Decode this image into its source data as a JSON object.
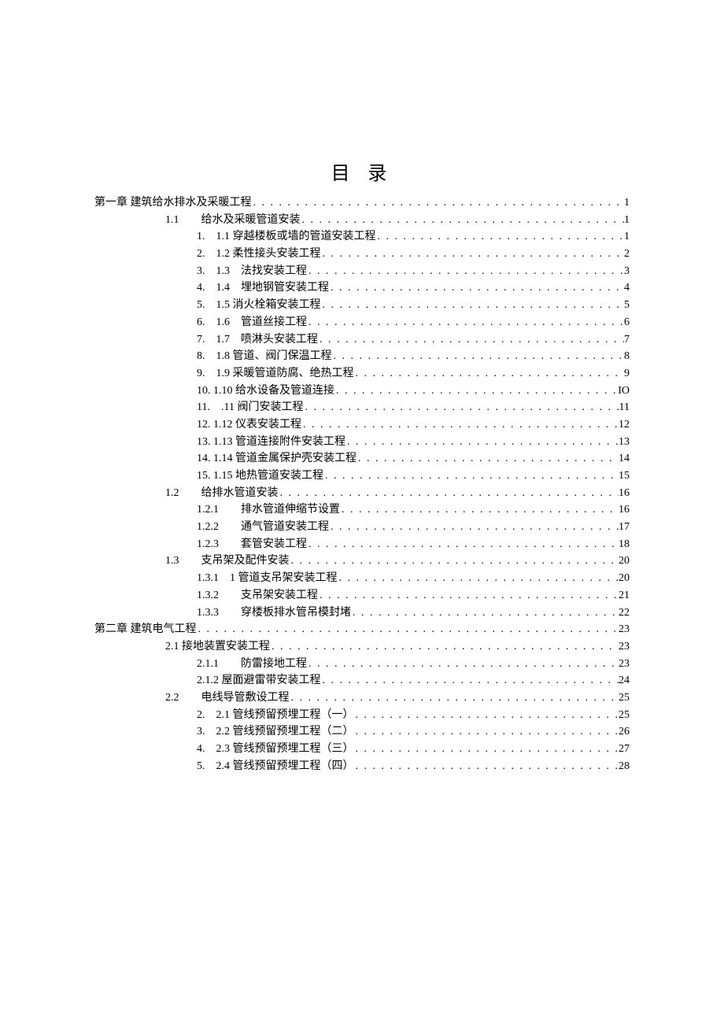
{
  "title": "目 录",
  "entries": [
    {
      "level": 0,
      "text": "第一章 建筑给水排水及采暖工程",
      "page": "1"
    },
    {
      "level": 1,
      "text": "1.1　　给水及采暖管道安装",
      "page": "1"
    },
    {
      "level": 2,
      "text": "1.　1.1 穿越楼板或墙的管道安装工程",
      "page": "1"
    },
    {
      "level": 2,
      "text": "2.　1.2 柔性接头安装工程",
      "page": "2"
    },
    {
      "level": 2,
      "text": "3.　1.3　法找安装工程",
      "page": "3"
    },
    {
      "level": 2,
      "text": "4.　1.4　埋地钢管安装工程",
      "page": "4"
    },
    {
      "level": 2,
      "text": "5.　1.5 消火栓箱安装工程",
      "page": "5"
    },
    {
      "level": 2,
      "text": "6.　1.6　管道丝接工程",
      "page": "6"
    },
    {
      "level": 2,
      "text": "7.　1.7　喷淋头安装工程",
      "page": "7"
    },
    {
      "level": 2,
      "text": "8.　1.8 管道、阀门保温工程",
      "page": "8"
    },
    {
      "level": 2,
      "text": "9.　1.9 采暖管道防腐、绝热工程",
      "page": "9"
    },
    {
      "level": 2,
      "text": "10. 1.10 给水设备及管道连接",
      "page": "IO"
    },
    {
      "level": 2,
      "text": "11.　.11 阀门安装工程",
      "page": "11"
    },
    {
      "level": 2,
      "text": "12. 1.12 仪表安装工程",
      "page": "12"
    },
    {
      "level": 2,
      "text": "13. 1.13 管道连接附件安装工程",
      "page": "13"
    },
    {
      "level": 2,
      "text": "14. 1.14 管道金属保护壳安装工程",
      "page": "14"
    },
    {
      "level": 2,
      "text": "15. 1.15 地热管道安装工程",
      "page": "15"
    },
    {
      "level": 1,
      "text": "1.2　　给排水管道安装",
      "page": "16"
    },
    {
      "level": 2,
      "text": "1.2.1　　排水管道伸缩节设置",
      "page": "16"
    },
    {
      "level": 2,
      "text": "1.2.2　　通气管道安装工程",
      "page": "17"
    },
    {
      "level": 2,
      "text": "1.2.3　　套管安装工程",
      "page": "18"
    },
    {
      "level": 1,
      "text": "1.3　　支吊架及配件安装",
      "page": "20"
    },
    {
      "level": 2,
      "text": "1.3.1　1 管道支吊架安装工程",
      "page": "20"
    },
    {
      "level": 2,
      "text": "1.3.2　　支吊架安装工程",
      "page": "21"
    },
    {
      "level": 2,
      "text": "1.3.3　　穿楼板排水管吊模封堵",
      "page": "22"
    },
    {
      "level": 0,
      "text": "第二章 建筑电气工程",
      "page": "23"
    },
    {
      "level": 1,
      "text": "2.1 接地装置安装工程",
      "page": "23"
    },
    {
      "level": 2,
      "text": "2.1.1　　防雷接地工程",
      "page": "23"
    },
    {
      "level": 2,
      "text": "2.1.2 屋面避雷带安装工程",
      "page": "24"
    },
    {
      "level": 1,
      "text": "2.2　　电线导管敷设工程",
      "page": "25"
    },
    {
      "level": 2,
      "text": "2.　2.1 管线预留预埋工程（一）",
      "page": "25"
    },
    {
      "level": 2,
      "text": "3.　2.2 管线预留预埋工程（二）",
      "page": "26"
    },
    {
      "level": 2,
      "text": "4.　2.3 管线预留预埋工程（三）",
      "page": "27"
    },
    {
      "level": 2,
      "text": "5.　2.4 管线预留预埋工程（四）",
      "page": "28"
    }
  ]
}
